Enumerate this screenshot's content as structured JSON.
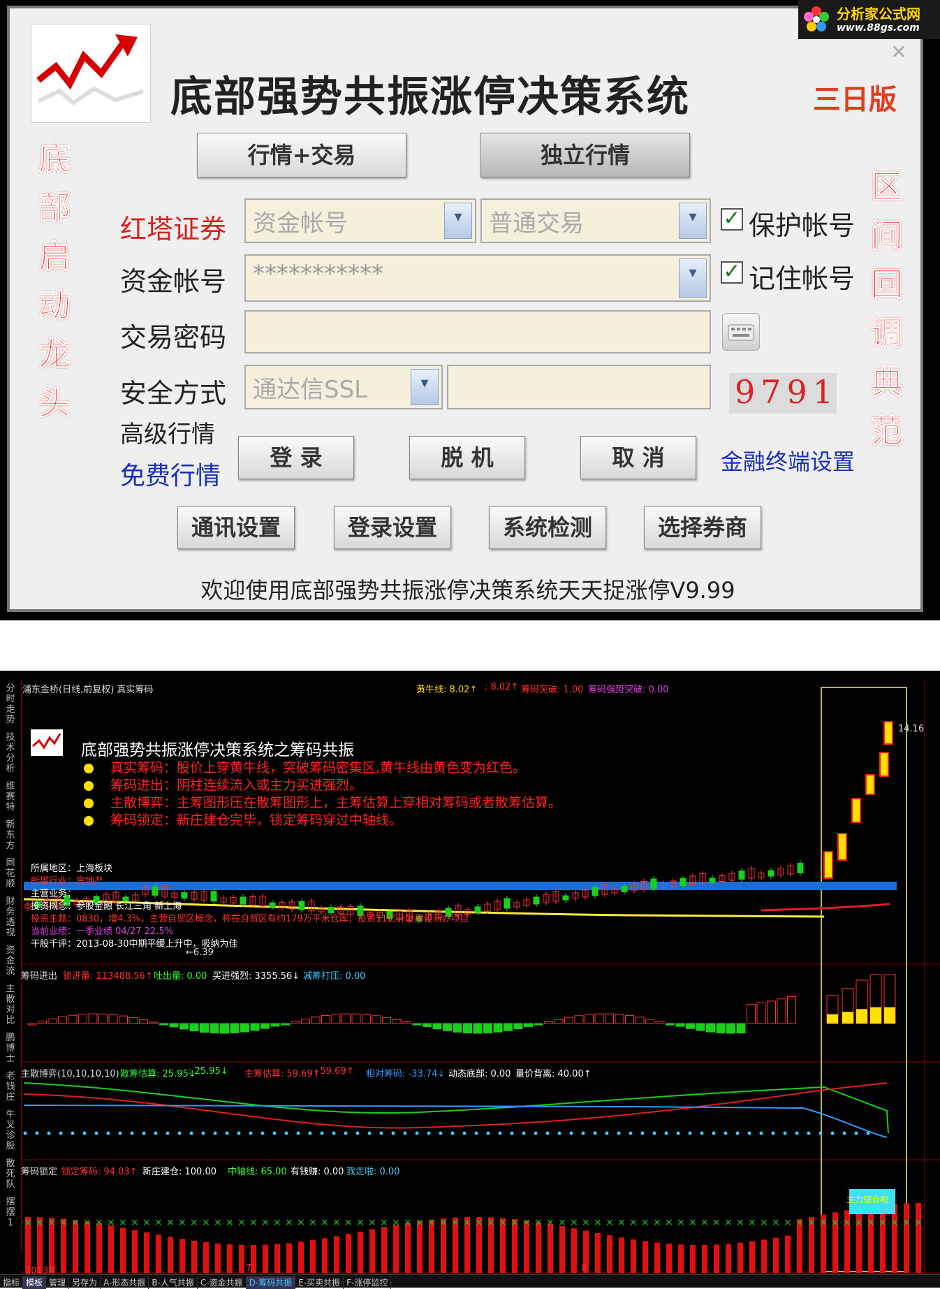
{
  "watermark": {
    "site": "分析家公式网",
    "url": "www.88gs.com"
  },
  "dialog": {
    "title": "底部强势共振涨停决策系统",
    "edition": "三日版",
    "left_vertical": "底部启动龙头",
    "right_vertical": "区间回调典范",
    "top_buttons": [
      "行情+交易",
      "独立行情"
    ],
    "broker_label": "红塔证券",
    "account_type": "资金帐号",
    "trade_type": "普通交易",
    "protect_account": "保护帐号",
    "account_label": "资金帐号",
    "account_value": "***********",
    "remember_account": "记住帐号",
    "password_label": "交易密码",
    "password_value": "",
    "security_label": "安全方式",
    "security_value": "通达信SSL",
    "captcha": "9791",
    "advanced_quote": "高级行情",
    "free_quote": "免费行情",
    "login": "登 录",
    "offline": "脱 机",
    "cancel": "取 消",
    "terminal_settings": "金融终端设置",
    "bottom_buttons": [
      "通讯设置",
      "登录设置",
      "系统检测",
      "选择券商"
    ],
    "welcome": "欢迎使用底部强势共振涨停决策系统天天捉涨停V9.99"
  },
  "chart": {
    "header_left": "浦东金桥(日线,前复权) 真实筹码",
    "header_right": {
      "huangniu": "黄牛线: 8.02↑",
      "huangniu2": ": 8.02↑",
      "tupo": "筹码突破: 1.00",
      "qiangshi": "筹码强势突破: 0.00"
    },
    "price_high": "14.16",
    "price_low": "←6.39",
    "overlay_title": "底部强势共振涨停决策系统之筹码共振",
    "bullets": [
      "真实筹码：股价上穿黄牛线，突破筹码密集区,黄牛线由黄色变为红色。",
      "筹码进出：阴柱连续流入或主力买进强烈。",
      "主散博弈：主筹图形压在散筹图形上，主筹估算上穿相对筹码或者散筹估算。",
      "筹码锁定：新庄建仓完毕，锁定筹码穿过中轴线。"
    ],
    "info_lines": [
      "所属地区：上海板块",
      "所属行业：房地产",
      "主营业务：",
      "投资概念：参股金融 长江三角 新上海",
      "投资主题：0830，增4.3%，主营自贸区概念，称在自贸区有约179万平米仓库，投资11亿开发建设商办项目",
      "当前业绩：一季业绩 04/27 22.5%",
      "干股千评：2013-08-30中期平缓上升中，吸纳为佳"
    ],
    "side_tabs": [
      "分时走势",
      "技术分析",
      "维赛特",
      "新东方",
      "同花顺",
      "财务透视",
      "资金流",
      "主散对比",
      "鹏博士",
      "老钱庄",
      "牛叉诊股",
      "散死队",
      "摆摆1"
    ],
    "panel1": {
      "title": "筹码进出",
      "suojin": "锁进量: 113488.56↑",
      "tuchu": "吐出量: 0.00",
      "maijin": "买进强烈: 3355.56↓",
      "jianchou": "减筹打压: 0.00"
    },
    "panel2": {
      "title": "主散博弈(10,10,10,10)",
      "sanchou": "散筹估算: 25.95↓",
      "sanchou2": ": 25.95↓",
      "zhuchou": "主筹估算: 59.69↑",
      "zhuchou2": ": 59.69↑",
      "xiangdui": "相对筹码: -33.74↓",
      "dongtai": "动态底部: 0.00",
      "liangjia": "量价背离: 40.00↑"
    },
    "panel3": {
      "title": "筹码锁定",
      "suoding": "锁定筹码: 94.03↑",
      "xinzhuang": "新庄建仓: 100.00",
      "zhongzhou": "中轴线: 65.00",
      "youqian": "有钱赚: 0.00",
      "wozoula": "我走啦: 0.00",
      "flag": "主力锁仓啦"
    },
    "axis": {
      "year": "2013年",
      "m7": "7",
      "m8": "8"
    },
    "bottom_tabs": [
      "指标",
      "模板",
      "管理",
      "另存为",
      "A-形态共振",
      "B-人气共振",
      "C-资金共振",
      "D-筹码共振",
      "E-买卖共振",
      "F-涨停监控"
    ]
  }
}
